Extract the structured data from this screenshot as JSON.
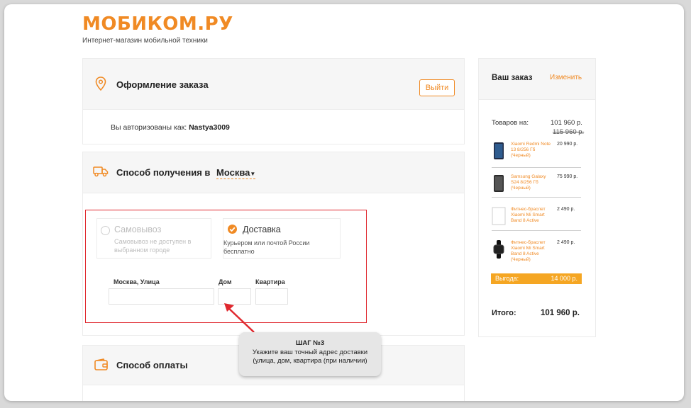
{
  "header": {
    "logo_text": "МОБИКОМ.РУ",
    "tagline": "Интернет-магазин мобильной техники"
  },
  "checkout": {
    "title": "Оформление заказа",
    "logout_label": "Выйти",
    "auth_prefix": "Вы авторизованы как:",
    "username": "Nastya3009"
  },
  "delivery": {
    "title": "Способ получения в",
    "city": "Москва",
    "pickup": {
      "title": "Самовывоз",
      "subtitle": "Самовывоз не доступен в выбранном городе"
    },
    "courier": {
      "title": "Доставка",
      "subtitle": "Курьером или почтой России бесплатно"
    },
    "fields": {
      "street_label": "Москва, Улица",
      "house_label": "Дом",
      "apartment_label": "Квартира"
    }
  },
  "payment": {
    "title": "Способ оплаты"
  },
  "tooltip": {
    "step": "ШАГ №3",
    "line1": "Укажите ваш точный адрес доставки",
    "line2": "(улица, дом, квартира (при наличии)"
  },
  "order": {
    "title": "Ваш заказ",
    "edit_label": "Изменить",
    "items_label": "Товаров на:",
    "items_total": "101 960 р.",
    "items_old_total": "115 960 р.",
    "items": [
      {
        "name": "Xiaomi Redmi Note 13 8/256 Гб (Черный)",
        "price": "20 990 р."
      },
      {
        "name": "Samsung Galaxy S24 8/256 Гб (Черный)",
        "price": "75 990 р."
      },
      {
        "name": "Фитнес-браслет Xiaomi Mi Smart Band 8 Active",
        "price": "2 490 р."
      },
      {
        "name": "Фитнес-браслет Xiaomi Mi Smart Band 8 Active (Черный)",
        "price": "2 490 р."
      }
    ],
    "benefit_label": "Выгода:",
    "benefit_value": "14 000 р.",
    "total_label": "Итого:",
    "total_value": "101 960 р."
  },
  "colors": {
    "accent": "#f08a24",
    "highlight_border": "#e0282e",
    "benefit_bg": "#f5a623"
  },
  "icons": [
    "location-pin-icon",
    "delivery-truck-icon",
    "wallet-icon",
    "check-icon",
    "arrow-icon"
  ]
}
